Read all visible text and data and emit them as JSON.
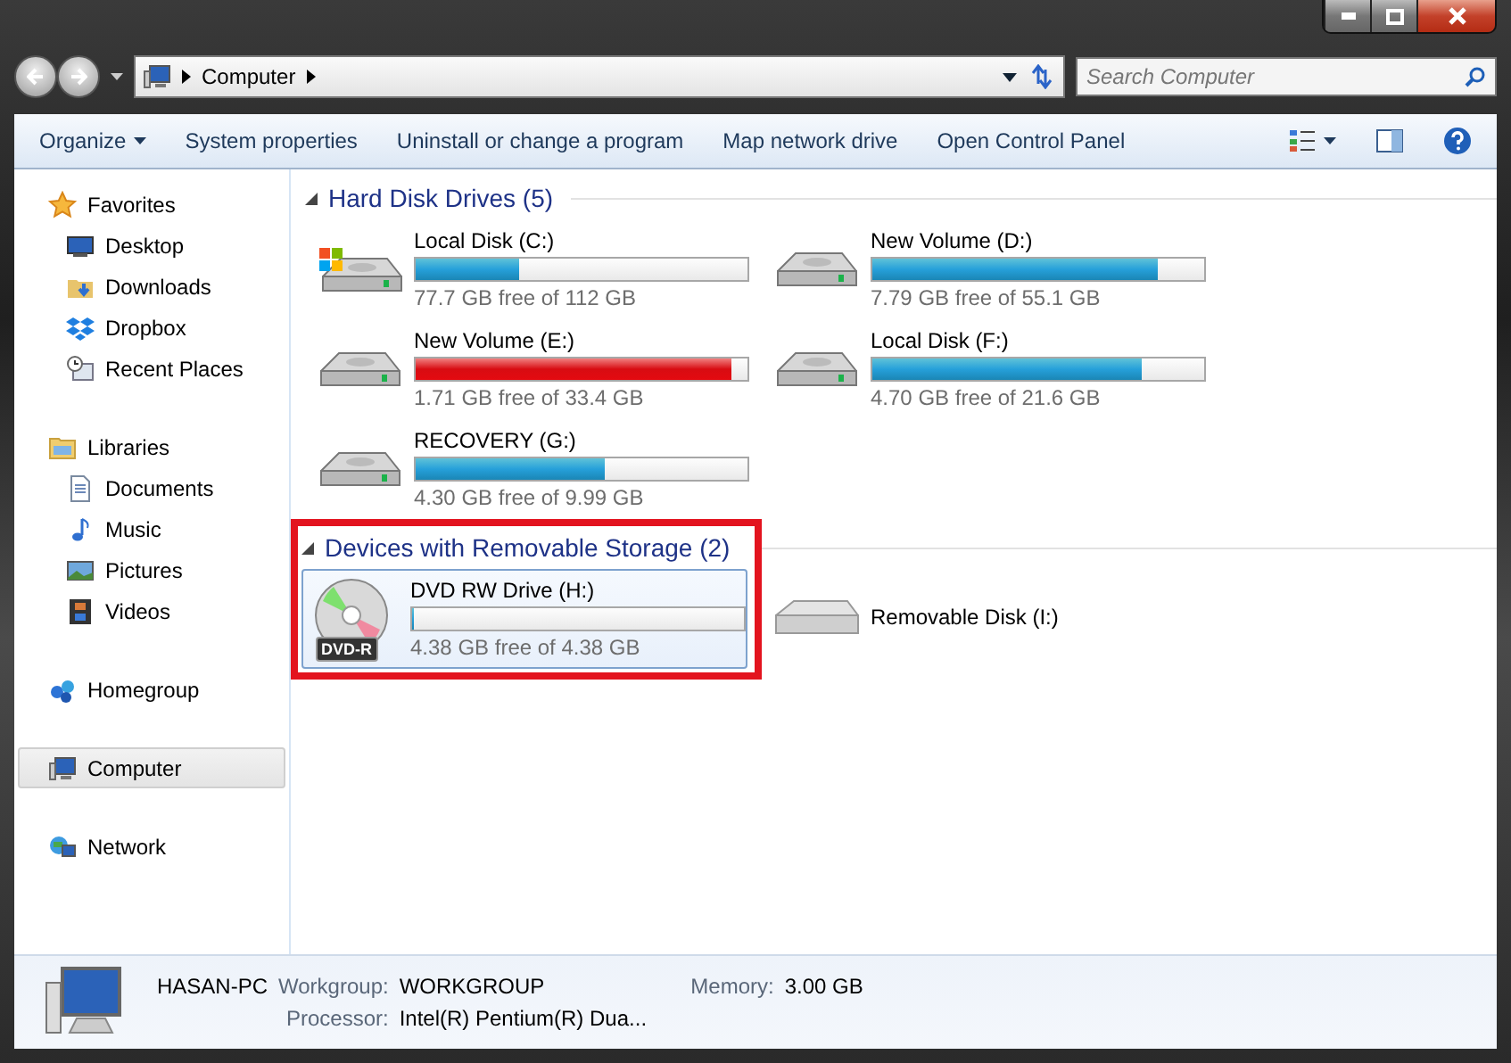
{
  "address": {
    "crumbs": [
      "Computer"
    ]
  },
  "search": {
    "placeholder": "Search Computer"
  },
  "toolbar": {
    "items": [
      {
        "label": "Organize",
        "kind": "menu"
      },
      {
        "label": "System properties",
        "kind": "plain"
      },
      {
        "label": "Uninstall or change a program",
        "kind": "plain"
      },
      {
        "label": "Map network drive",
        "kind": "plain"
      },
      {
        "label": "Open Control Panel",
        "kind": "plain"
      }
    ]
  },
  "sidebar": {
    "groups": [
      {
        "label": "Favorites",
        "selected": false,
        "children": [
          {
            "label": "Desktop"
          },
          {
            "label": "Downloads"
          },
          {
            "label": "Dropbox"
          },
          {
            "label": "Recent Places"
          }
        ]
      },
      {
        "label": "Libraries",
        "selected": false,
        "children": [
          {
            "label": "Documents"
          },
          {
            "label": "Music"
          },
          {
            "label": "Pictures"
          },
          {
            "label": "Videos"
          }
        ]
      },
      {
        "label": "Homegroup",
        "selected": false
      },
      {
        "label": "Computer",
        "selected": true
      },
      {
        "label": "Network",
        "selected": false
      }
    ]
  },
  "sections": [
    {
      "title": "Hard Disk Drives (5)",
      "expanded": true,
      "drives": [
        {
          "name": "Local Disk (C:)",
          "kind": "system",
          "selected": false,
          "level": 0.31,
          "warning": false,
          "space": "77.7 GB free of 112 GB"
        },
        {
          "name": "New Volume (D:)",
          "kind": "hdd",
          "selected": false,
          "level": 0.86,
          "warning": false,
          "space": "7.79 GB free of 55.1 GB"
        },
        {
          "name": "New Volume (E:)",
          "kind": "hdd",
          "selected": false,
          "level": 0.95,
          "warning": true,
          "space": "1.71 GB free of 33.4 GB"
        },
        {
          "name": "Local Disk (F:)",
          "kind": "hdd",
          "selected": false,
          "level": 0.81,
          "warning": false,
          "space": "4.70 GB free of 21.6 GB"
        },
        {
          "name": "RECOVERY (G:)",
          "kind": "hdd",
          "selected": false,
          "level": 0.57,
          "warning": false,
          "space": "4.30 GB free of 9.99 GB"
        }
      ]
    },
    {
      "title": "Devices with Removable Storage (2)",
      "expanded": true,
      "highlighted": true,
      "drives": [
        {
          "name": "DVD RW Drive (H:)",
          "kind": "dvd",
          "badge": "DVD-R",
          "selected": true,
          "level": 0,
          "space": "4.38 GB free of 4.38 GB"
        },
        {
          "name": "Removable Disk (I:)",
          "kind": "removable",
          "selected": false
        }
      ]
    }
  ],
  "details": {
    "computer_name": "HASAN-PC",
    "fields": [
      {
        "label": "Workgroup:",
        "value": "WORKGROUP"
      },
      {
        "label": "Memory:",
        "value": "3.00 GB"
      },
      {
        "label": "Processor:",
        "value": "Intel(R) Pentium(R) Dua..."
      }
    ]
  }
}
